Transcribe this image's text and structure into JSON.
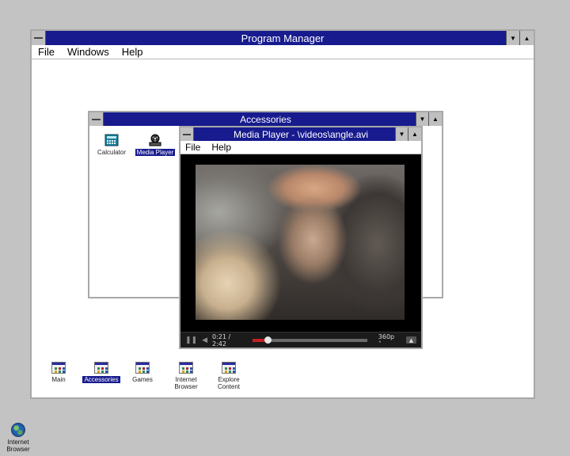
{
  "program_manager": {
    "title": "Program Manager",
    "menu": [
      "File",
      "Windows",
      "Help"
    ],
    "groups": [
      {
        "label": "Main",
        "selected": false
      },
      {
        "label": "Accessories",
        "selected": true
      },
      {
        "label": "Games",
        "selected": false
      },
      {
        "label": "Internet\nBrowser",
        "selected": false
      },
      {
        "label": "Explore\nContent",
        "selected": false
      }
    ]
  },
  "accessories": {
    "title": "Accessories",
    "items": [
      {
        "label": "Calculator",
        "icon": "calculator-icon",
        "selected": false
      },
      {
        "label": "Media Player",
        "icon": "film-reel-icon",
        "selected": true
      }
    ]
  },
  "media_player": {
    "title": "Media Player - \\videos\\angle.avi",
    "menu": [
      "File",
      "Help"
    ],
    "controls": {
      "time": "0:21 / 2:42",
      "quality": "360p",
      "progress": 0.13
    }
  },
  "desktop": {
    "icons": [
      {
        "label": "Internet\nBrowser",
        "icon": "globe-icon"
      }
    ]
  },
  "colors": {
    "titlebar": "#171b8e",
    "desktop": "#c3c3c3",
    "selection": "#171b8e",
    "progress": "#c62020"
  }
}
